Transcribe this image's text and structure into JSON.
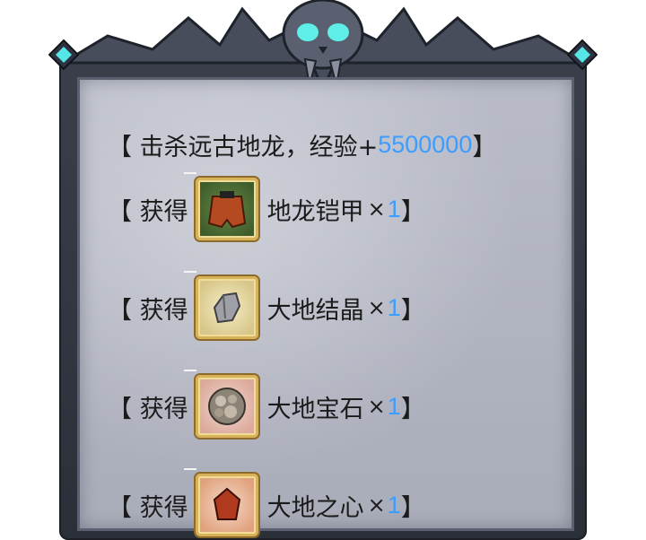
{
  "messages": [
    {
      "prefix": "【 击杀远古地龙，经验+",
      "value": "5500000",
      "suffix": " 】"
    },
    {
      "prefix": "【 获得",
      "item": "地龙铠甲",
      "times": "×",
      "qty": "1",
      "suffix": " 】",
      "icon": "armor-icon"
    },
    {
      "prefix": "【 获得",
      "item": "大地结晶",
      "times": "×",
      "qty": "1",
      "suffix": " 】",
      "icon": "crystal-icon"
    },
    {
      "prefix": "【 获得",
      "item": "大地宝石",
      "times": "×",
      "qty": "1",
      "suffix": " 】",
      "icon": "gemstone-icon"
    },
    {
      "prefix": "【 获得",
      "item": "大地之心",
      "times": "×",
      "qty": "1",
      "suffix": " 】",
      "icon": "earth-heart-icon"
    }
  ],
  "colors": {
    "highlight_number": "#3d9cff",
    "panel": "#b0b3bf",
    "frame": "#333842"
  }
}
